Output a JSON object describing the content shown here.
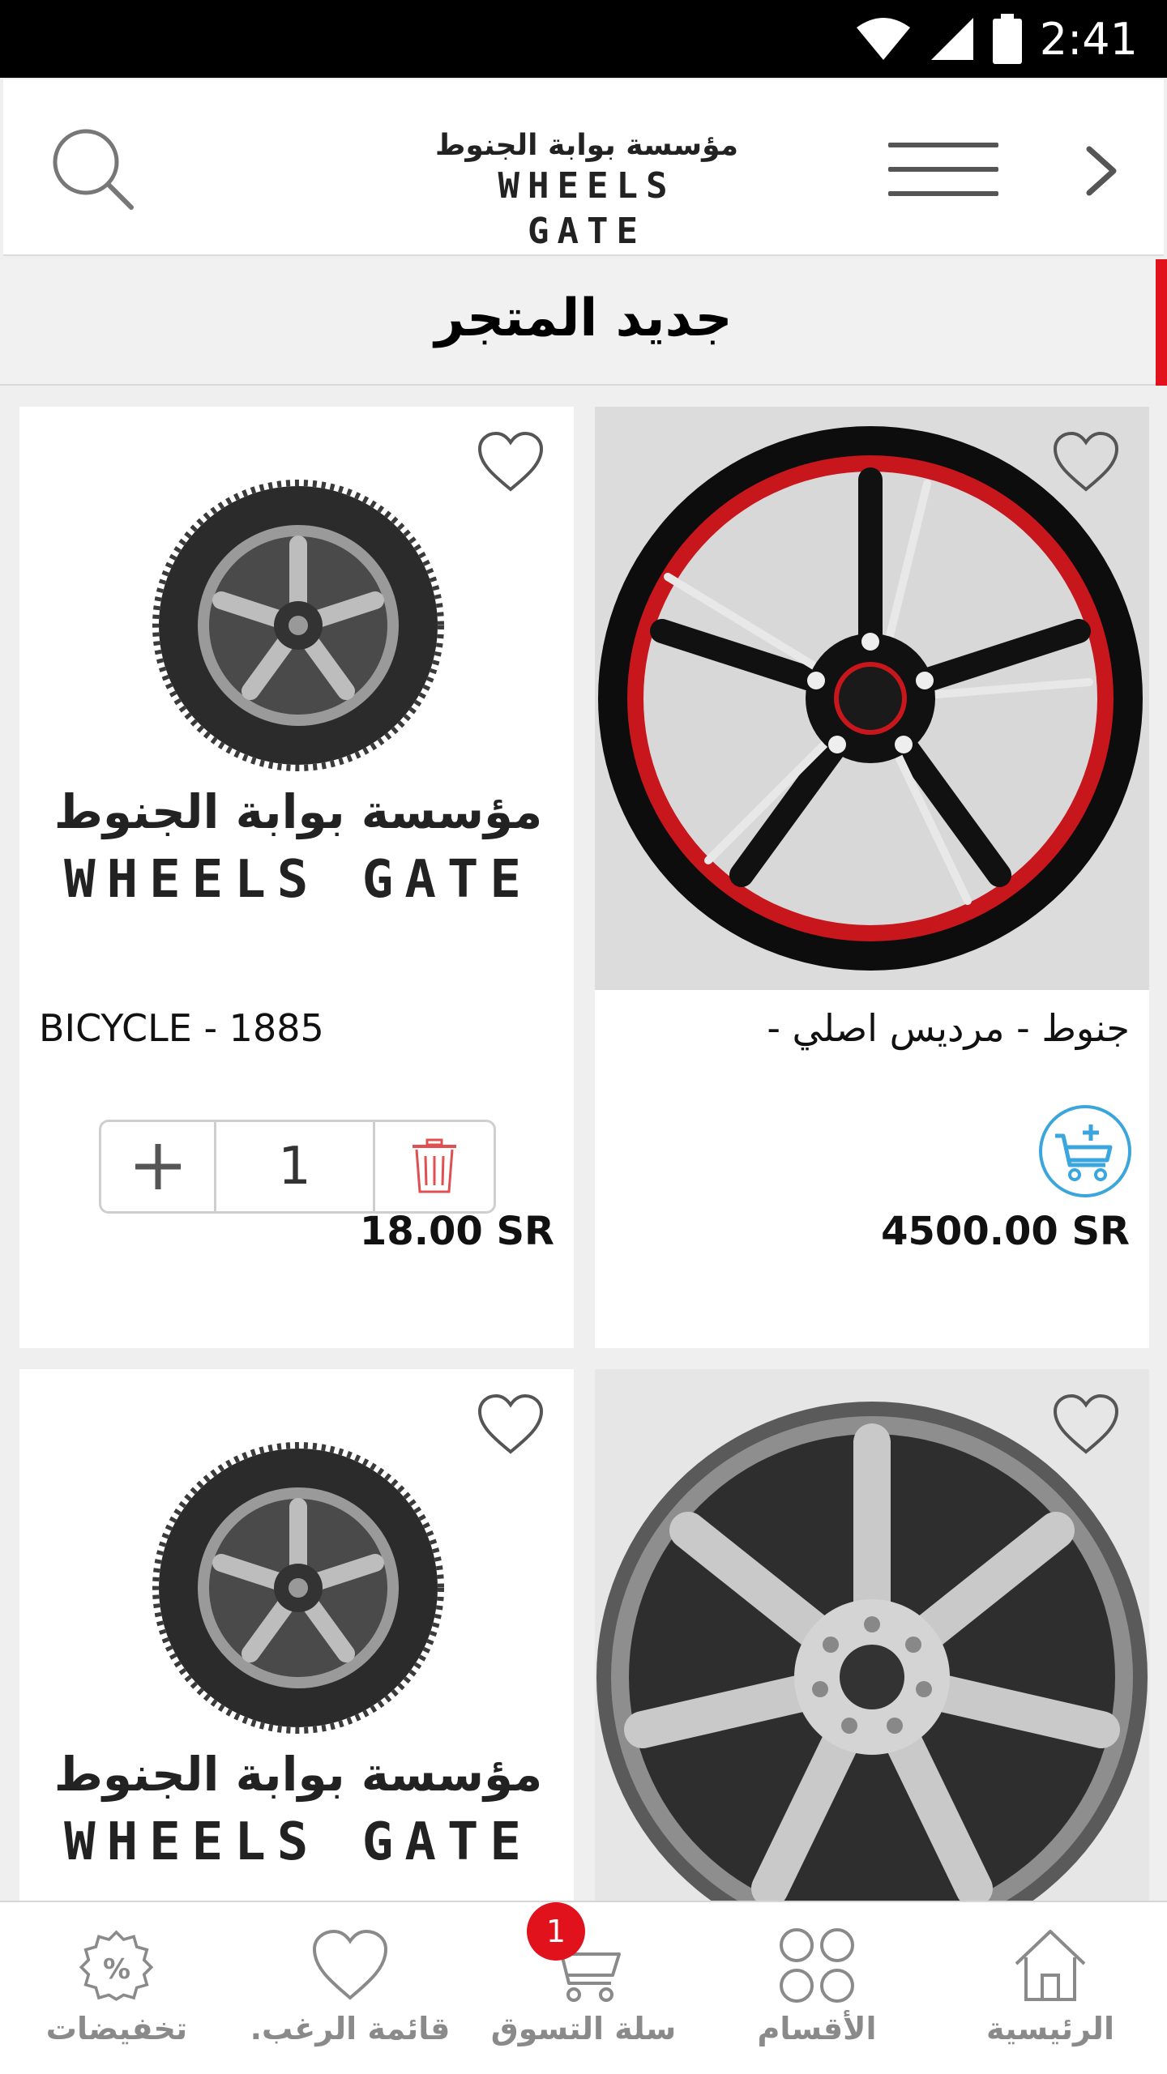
{
  "status_bar": {
    "time": "2:41"
  },
  "header": {
    "logo_arabic": "مؤسسة بوابة الجنوط",
    "logo_english": "WHEELS GATE",
    "icons": {
      "search": "search-icon",
      "menu": "menu-icon",
      "back": "chevron-right-icon"
    }
  },
  "section": {
    "title": "جديد المتجر"
  },
  "products": [
    {
      "name": "BICYCLE - 1885",
      "price": "18.00 SR",
      "image": "wheels-gate-logo-tire",
      "image_logo_arabic": "مؤسسة بوابة الجنوط",
      "image_logo_english": "WHEELS GATE",
      "in_cart": true,
      "quantity": "1"
    },
    {
      "name": "جنوط - مرديس اصلي -",
      "price": "4500.00 SR",
      "image": "black-red-alloy-rim",
      "in_cart": false
    },
    {
      "name": "",
      "price": "",
      "image": "wheels-gate-logo-tire",
      "image_logo_arabic": "مؤسسة بوابة الجنوط",
      "image_logo_english": "WHEELS GATE"
    },
    {
      "name": "",
      "price": "",
      "image": "silver-seven-spoke-rim"
    }
  ],
  "bottom_nav": {
    "items": [
      {
        "label": "تخفيضات",
        "icon": "discount-badge-icon"
      },
      {
        "label": "قائمة الرغب.",
        "icon": "heart-icon"
      },
      {
        "label": "سلة التسوق",
        "icon": "cart-icon"
      },
      {
        "label": "الأقسام",
        "icon": "grid-icon"
      },
      {
        "label": "الرئيسية",
        "icon": "home-icon"
      }
    ],
    "cart_badge": "1"
  },
  "colors": {
    "accent": "#e1121b",
    "add_cart": "#3aa6dc",
    "delete": "#e05050",
    "nav_text": "#8a8a8a"
  }
}
